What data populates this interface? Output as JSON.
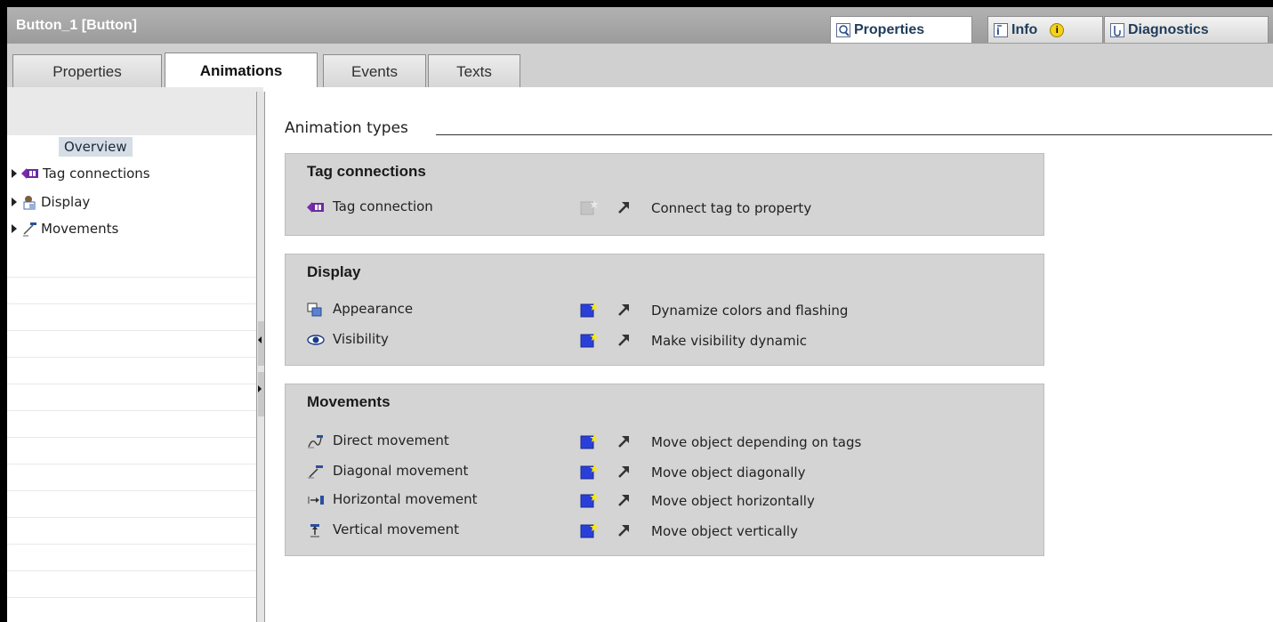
{
  "window": {
    "title": "Button_1 [Button]",
    "tabs": {
      "properties": "Properties",
      "info": "Info",
      "diagnostics": "Diagnostics"
    }
  },
  "tabs": [
    "Properties",
    "Animations",
    "Events",
    "Texts"
  ],
  "active_tab": "Animations",
  "tree": {
    "overview": "Overview",
    "items": [
      "Tag connections",
      "Display",
      "Movements"
    ]
  },
  "main": {
    "section_title": "Animation types",
    "panels": [
      {
        "title": "Tag connections",
        "rows": [
          {
            "label": "Tag connection",
            "description": "Connect tag to property",
            "icon": "tag-connection-icon",
            "enabled": false
          }
        ]
      },
      {
        "title": "Display",
        "rows": [
          {
            "label": "Appearance",
            "description": "Dynamize colors and flashing",
            "icon": "appearance-icon",
            "enabled": true
          },
          {
            "label": "Visibility",
            "description": "Make visibility dynamic",
            "icon": "visibility-icon",
            "enabled": true
          }
        ]
      },
      {
        "title": "Movements",
        "rows": [
          {
            "label": "Direct movement",
            "description": "Move object depending on tags",
            "icon": "direct-movement-icon",
            "enabled": true
          },
          {
            "label": "Diagonal movement",
            "description": "Move object diagonally",
            "icon": "diagonal-movement-icon",
            "enabled": true
          },
          {
            "label": "Horizontal movement",
            "description": "Move object horizontally",
            "icon": "horizontal-movement-icon",
            "enabled": true
          },
          {
            "label": "Vertical movement",
            "description": "Move object vertically",
            "icon": "vertical-movement-icon",
            "enabled": true
          }
        ]
      }
    ]
  },
  "colors": {
    "titlebar": "#a8a8a8",
    "panel": "#d4d4d4",
    "new_icon": "#2a3fd8",
    "tag_icon": "#6a2aa0"
  }
}
